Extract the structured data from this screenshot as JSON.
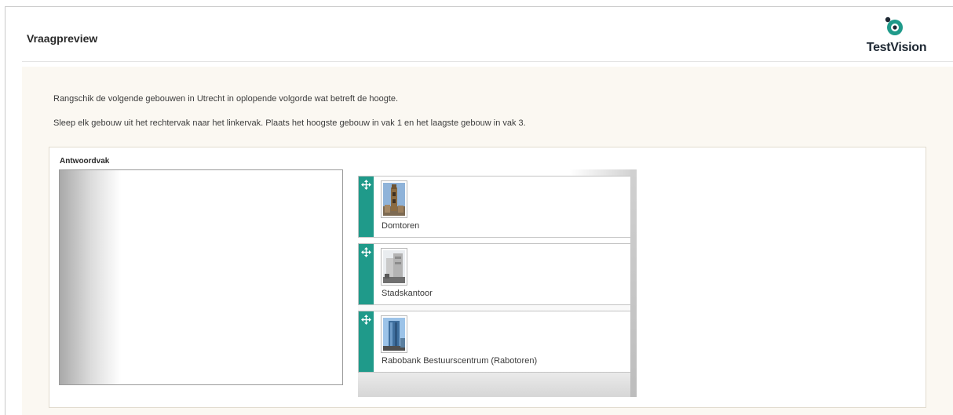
{
  "header": {
    "title": "Vraagpreview",
    "brand": "TestVision"
  },
  "question": {
    "instruction_1": "Rangschik de volgende gebouwen in Utrecht in oplopende volgorde wat betreft de hoogte.",
    "instruction_2": "Sleep elk gebouw uit het rechtervak naar het linkervak. Plaats het hoogste gebouw in vak 1 en het laagste gebouw in vak 3.",
    "answer_label": "Antwoordvak",
    "items": [
      {
        "label": "Domtoren",
        "image": "domtoren-photo"
      },
      {
        "label": "Stadskantoor",
        "image": "stadskantoor-photo"
      },
      {
        "label": "Rabobank Bestuurscentrum (Rabotoren)",
        "image": "rabotoren-photo"
      }
    ]
  },
  "colors": {
    "accent": "#1f9a8a",
    "panel_bg": "#fbf8f2",
    "brand_text": "#1e2833"
  },
  "icons": {
    "drag_handle": "move-arrows-icon",
    "logo": "testvision-logo-icon"
  }
}
